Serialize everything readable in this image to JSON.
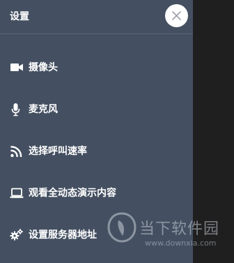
{
  "panel": {
    "title": "设置",
    "close_icon": "close-icon"
  },
  "menu": {
    "items": [
      {
        "label": "摄像头",
        "icon": "video-camera-icon"
      },
      {
        "label": "麦克风",
        "icon": "microphone-icon"
      },
      {
        "label": "选择呼叫速率",
        "icon": "rss-icon"
      },
      {
        "label": "观看全动态演示内容",
        "icon": "laptop-icon"
      },
      {
        "label": "设置服务器地址",
        "icon": "gears-icon"
      }
    ]
  },
  "watermark": {
    "name": "当下软件园",
    "url": "www.downxia.com"
  },
  "colors": {
    "panel_bg": "#445061",
    "backdrop": "#1f1f1f",
    "text": "#ffffff"
  }
}
